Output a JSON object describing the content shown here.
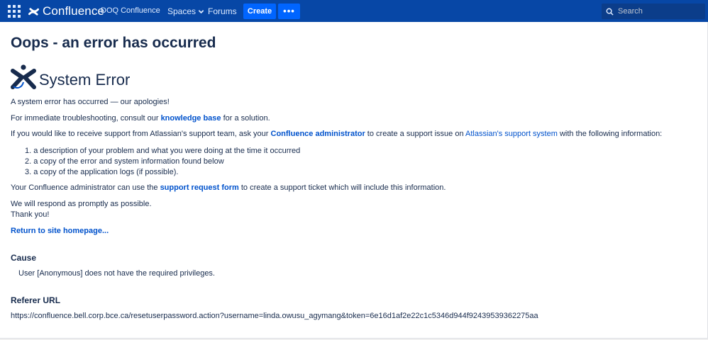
{
  "nav": {
    "logo_text": "Confluence",
    "site_name": "DOQ Confluence",
    "spaces_label": "Spaces",
    "forums_label": "Forums",
    "create_label": "Create",
    "more_label": "•••",
    "search_placeholder": "Search"
  },
  "page": {
    "title": "Oops - an error has occurred",
    "error_title": "System Error",
    "apology": "A system error has occurred — our apologies!",
    "troubleshoot": {
      "before": "For immediate troubleshooting, consult our ",
      "link": "knowledge base",
      "after": " for a solution."
    },
    "support": {
      "before": "If you would like to receive support from Atlassian's support team, ask your ",
      "admin_link": "Confluence administrator",
      "middle": " to create a support issue on ",
      "system_link": "Atlassian's support system",
      "after": " with the following information:"
    },
    "list": [
      "1. a description of your problem and what you were doing at the time it occurred",
      "2. a copy of the error and system information found below",
      "3. a copy of the application logs (if possible)."
    ],
    "request": {
      "before": "Your Confluence administrator can use the ",
      "link": "support request form",
      "after": " to create a support ticket which will include this information."
    },
    "respond": "We will respond as promptly as possible.",
    "thanks": "Thank you!",
    "return_link": "Return to site homepage..."
  },
  "cause": {
    "heading": "Cause",
    "text": "User [Anonymous] does not have the required privileges."
  },
  "referer": {
    "heading": "Referer URL",
    "url": "https://confluence.bell.corp.bce.ca/resetuserpassword.action?username=linda.owusu_agymang&token=6e16d1af2e22c1c5346d944f92439539362275aa"
  },
  "colors": {
    "nav_bg": "#0747a6",
    "button_bg": "#0065ff",
    "link": "#0052cc",
    "text": "#172b4d"
  },
  "icons": [
    "app-switcher-icon",
    "confluence-logo-icon",
    "chevron-down-icon",
    "search-icon",
    "system-error-icon"
  ]
}
